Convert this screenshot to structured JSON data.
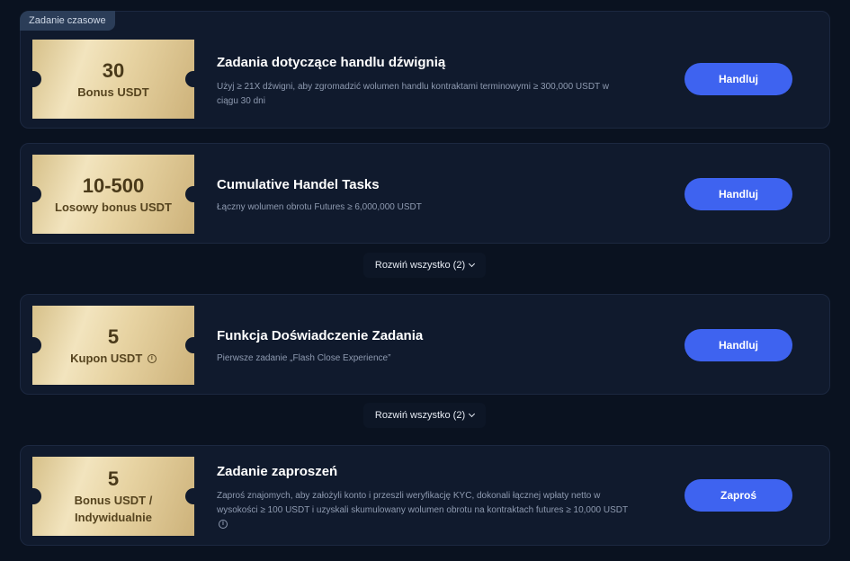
{
  "section_tag": "Zadanie czasowe",
  "tasks": [
    {
      "amount": "30",
      "unit": "Bonus USDT",
      "title": "Zadania dotyczące handlu dźwignią",
      "description": "Użyj ≥ 21X dźwigni, aby zgromadzić wolumen handlu kontraktami terminowymi ≥ 300,000 USDT w ciągu 30 dni",
      "button": "Handluj"
    },
    {
      "amount": "10-500",
      "unit": "Losowy bonus USDT",
      "title": "Cumulative Handel Tasks",
      "description": "Łączny wolumen obrotu Futures ≥ 6,000,000 USDT",
      "button": "Handluj"
    },
    {
      "amount": "5",
      "unit": "Kupon USDT",
      "title": "Funkcja Doświadczenie Zadania",
      "description": "Pierwsze zadanie „Flash Close Experience”",
      "button": "Handluj"
    },
    {
      "amount": "5",
      "unit": "Bonus USDT / Indywidualnie",
      "title": "Zadanie zaproszeń",
      "description": "Zaproś znajomych, aby założyli konto i przeszli weryfikację KYC, dokonali łącznej wpłaty netto w wysokości ≥ 100 USDT i uzyskali skumulowany wolumen obrotu na kontraktach futures ≥ 10,000 USDT",
      "button": "Zaproś"
    }
  ],
  "expand_labels": [
    "Rozwiń wszystko (2)",
    "Rozwiń wszystko (2)"
  ],
  "icons": {
    "info": "info-circle-icon",
    "chevron": "chevron-down-icon"
  },
  "colors": {
    "accent": "#3e63f0",
    "background": "#0a1220",
    "card": "#101a2d",
    "coupon_gold": "#e7d3a2"
  }
}
